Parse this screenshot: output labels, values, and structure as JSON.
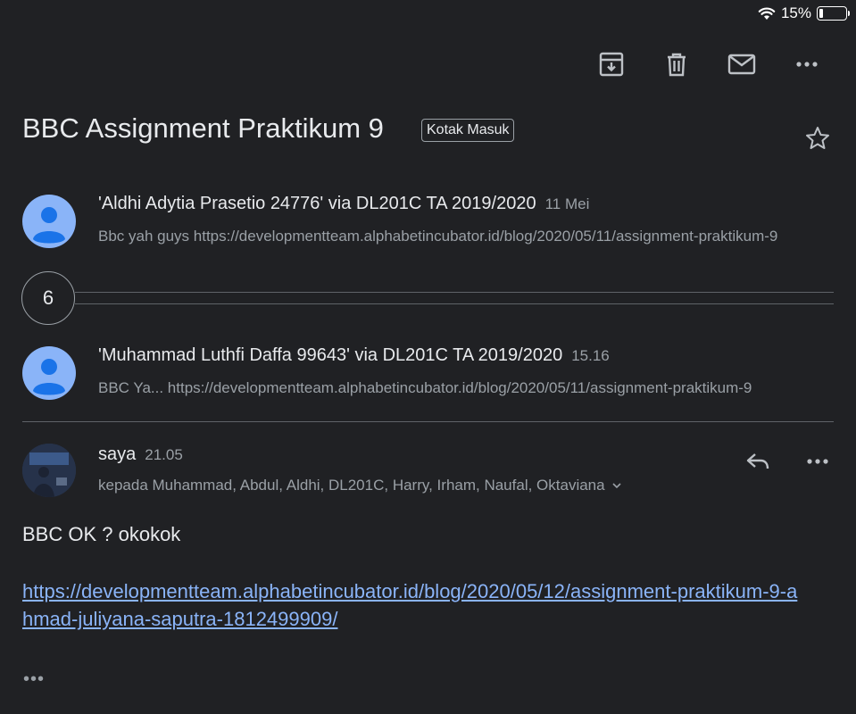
{
  "status_bar": {
    "battery_text": "15%",
    "battery_level": 0.15,
    "wifi_icon": "wifi-icon"
  },
  "toolbar": {
    "icons": [
      "archive-icon",
      "delete-icon",
      "mark-unread-icon",
      "more-icon"
    ]
  },
  "subject": "BBC Assignment Praktikum 9",
  "label": "Kotak Masuk",
  "messages": [
    {
      "sender": "'Aldhi Adytia Prasetio 24776' via DL201C TA 2019/2020",
      "time": "11 Mei",
      "snippet": "Bbc yah guys https://developmentteam.alphabetincubator.id/blog/2020/05/11/assignment-praktikum-9"
    },
    {
      "sender": "'Muhammad Luthfi Daffa 99643' via DL201C TA 2019/2020",
      "time": "15.16",
      "snippet": "BBC Ya... https://developmentteam.alphabetincubator.id/blog/2020/05/11/assignment-praktikum-9"
    }
  ],
  "collapsed_count": "6",
  "expanded_message": {
    "sender": "saya",
    "time": "21.05",
    "recipients": "kepada Muhammad, Abdul, Aldhi, DL201C, Harry, Irham, Naufal, Oktaviana",
    "body": "BBC OK ? okokok",
    "link": "https://developmentteam.alphabetincubator.id/blog/2020/05/12/assignment-praktikum-9-ahmad-juliyana-saputra-1812499909/",
    "trimmed_content": "•••"
  },
  "colors": {
    "background": "#202124",
    "link": "#8ab4f8",
    "avatar": "#8ab4f8",
    "secondary_text": "#9aa0a6"
  }
}
